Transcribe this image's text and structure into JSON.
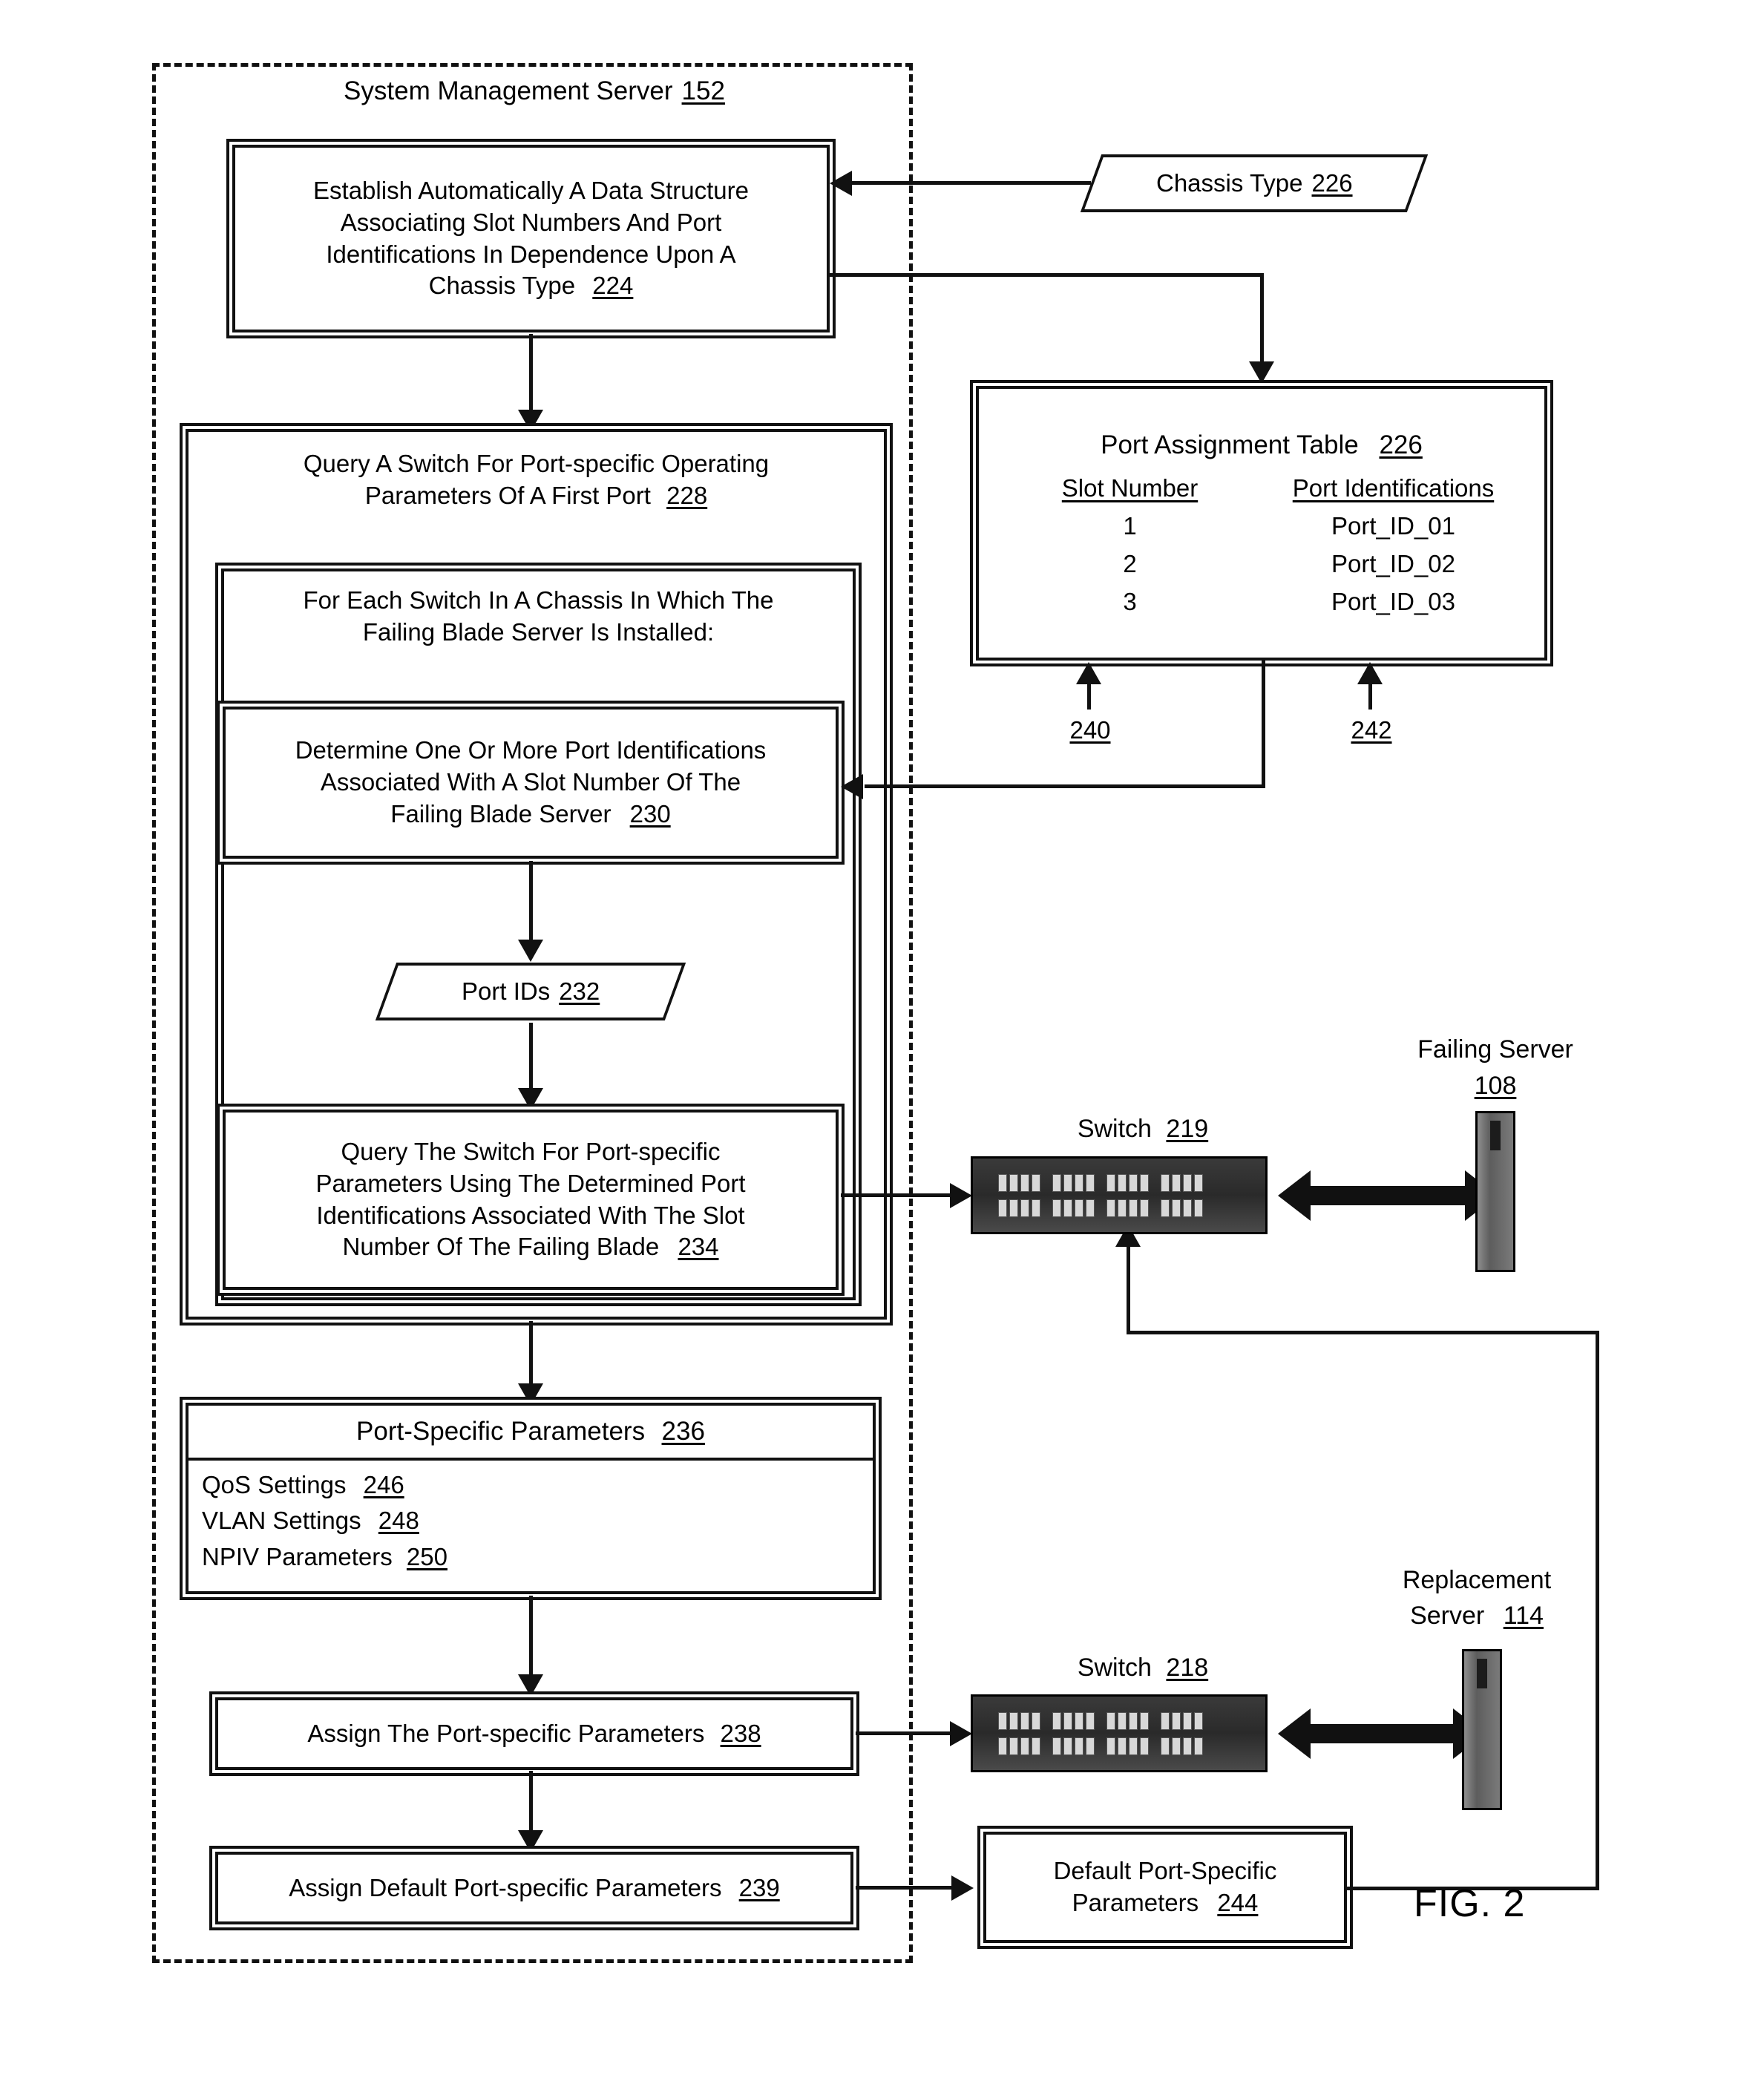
{
  "figure": {
    "caption": "FIG. 2"
  },
  "boundary": {
    "title": "System Management Server",
    "ref": "152"
  },
  "nodes": {
    "establish": {
      "lines": [
        "Establish Automatically A Data Structure",
        "Associating Slot Numbers And Port",
        "Identifications In Dependence Upon A",
        "Chassis Type"
      ],
      "ref": "224"
    },
    "chassis_type_input": {
      "label": "Chassis Type",
      "ref": "226"
    },
    "query_switch": {
      "lines": [
        "Query A Switch For Port-specific Operating",
        "Parameters Of A First Port"
      ],
      "ref": "228"
    },
    "for_each_switch": {
      "lines": [
        "For Each Switch In A Chassis In Which The",
        "Failing Blade Server Is Installed:"
      ],
      "ref": ""
    },
    "determine_ids": {
      "lines": [
        "Determine One Or More Port Identifications",
        "Associated With A Slot Number Of The",
        "Failing Blade Server"
      ],
      "ref": "230"
    },
    "port_ids_data": {
      "label": "Port IDs",
      "ref": "232"
    },
    "query_the_switch": {
      "lines": [
        "Query The Switch For Port-specific",
        "Parameters Using The Determined Port",
        "Identifications Associated With The Slot",
        "Number Of The Failing Blade"
      ],
      "ref": "234"
    },
    "port_specific_params": {
      "title": "Port-Specific Parameters",
      "ref": "236",
      "items": [
        {
          "label": "QoS Settings",
          "ref": "246"
        },
        {
          "label": "VLAN Settings",
          "ref": "248"
        },
        {
          "label": "NPIV Parameters",
          "ref": "250"
        }
      ]
    },
    "assign_params": {
      "label": "Assign The Port-specific Parameters",
      "ref": "238"
    },
    "assign_default_params": {
      "label": "Assign Default Port-specific Parameters",
      "ref": "239"
    },
    "default_params_store": {
      "lines": [
        "Default Port-Specific",
        "Parameters"
      ],
      "ref": "244"
    }
  },
  "port_assignment_table": {
    "title": "Port Assignment Table",
    "ref": "226",
    "columns": [
      "Slot Number",
      "Port Identifications"
    ],
    "rows": [
      [
        "1",
        "Port_ID_01"
      ],
      [
        "2",
        "Port_ID_02"
      ],
      [
        "3",
        "Port_ID_03"
      ]
    ],
    "col_refs": [
      "240",
      "242"
    ]
  },
  "hardware": {
    "switch_top": {
      "label": "Switch",
      "ref": "219"
    },
    "switch_bottom": {
      "label": "Switch",
      "ref": "218"
    },
    "failing_server": {
      "lines": [
        "Failing Server"
      ],
      "ref": "108"
    },
    "replacement_server": {
      "lines": [
        "Replacement",
        "Server"
      ],
      "ref": "114"
    }
  },
  "colors": {
    "ink": "#111111",
    "paper": "#ffffff",
    "switch_body": "#2f2f2f",
    "blade_body": "#6d6d6d"
  }
}
